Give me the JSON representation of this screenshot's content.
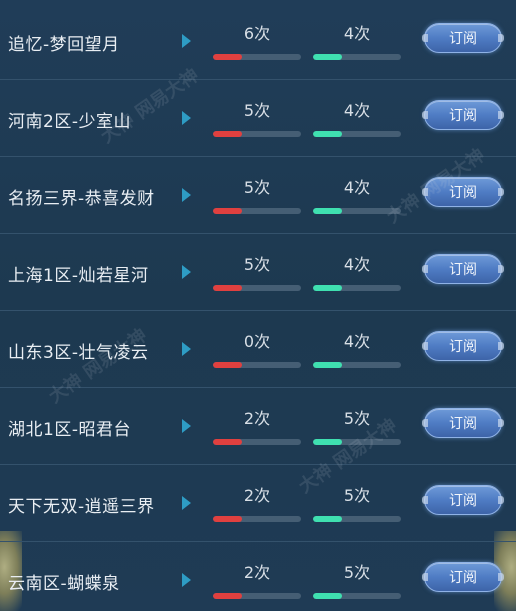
{
  "subscribe_label": "订阅",
  "watermark_text": "大神 网易大神",
  "rows": [
    {
      "name": "追忆-梦回望月",
      "red_value": "6次",
      "green_value": "4次",
      "red_fill": 0.33,
      "green_fill": 0.33
    },
    {
      "name": "河南2区-少室山",
      "red_value": "5次",
      "green_value": "4次",
      "red_fill": 0.33,
      "green_fill": 0.33
    },
    {
      "name": "名扬三界-恭喜发财",
      "red_value": "5次",
      "green_value": "4次",
      "red_fill": 0.33,
      "green_fill": 0.33
    },
    {
      "name": "上海1区-灿若星河",
      "red_value": "5次",
      "green_value": "4次",
      "red_fill": 0.33,
      "green_fill": 0.33
    },
    {
      "name": "山东3区-壮气凌云",
      "red_value": "0次",
      "green_value": "4次",
      "red_fill": 0.33,
      "green_fill": 0.33
    },
    {
      "name": "湖北1区-昭君台",
      "red_value": "2次",
      "green_value": "5次",
      "red_fill": 0.33,
      "green_fill": 0.33
    },
    {
      "name": "天下无双-逍遥三界",
      "red_value": "2次",
      "green_value": "5次",
      "red_fill": 0.33,
      "green_fill": 0.33
    },
    {
      "name": "云南区-蝴蝶泉",
      "red_value": "2次",
      "green_value": "5次",
      "red_fill": 0.33,
      "green_fill": 0.33
    }
  ],
  "colors": {
    "background": "#1e3a54",
    "red_bar": "#e0403f",
    "green_bar": "#3fe0b0",
    "button": "#4f7cc4",
    "arrow": "#2e9cc4"
  }
}
